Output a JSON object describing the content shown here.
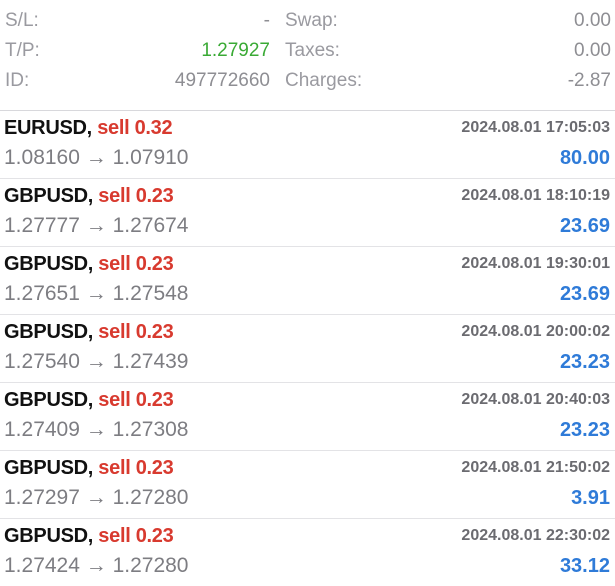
{
  "details": {
    "sl_label": "S/L:",
    "sl_value": "-",
    "tp_label": "T/P:",
    "tp_value": "1.27927",
    "id_label": "ID:",
    "id_value": "497772660",
    "swap_label": "Swap:",
    "swap_value": "0.00",
    "taxes_label": "Taxes:",
    "taxes_value": "0.00",
    "charges_label": "Charges:",
    "charges_value": "-2.87"
  },
  "colors": {
    "sell": "#d83a2f",
    "profit": "#2f7bd8",
    "tp": "#3aaa35"
  },
  "orders": [
    {
      "symbol": "EURUSD,",
      "side": "sell 0.32",
      "time": "2024.08.01 17:05:03",
      "prices": "1.08160 → 1.07910",
      "profit": "80.00"
    },
    {
      "symbol": "GBPUSD,",
      "side": "sell 0.23",
      "time": "2024.08.01 18:10:19",
      "prices": "1.27777 → 1.27674",
      "profit": "23.69"
    },
    {
      "symbol": "GBPUSD,",
      "side": "sell 0.23",
      "time": "2024.08.01 19:30:01",
      "prices": "1.27651 → 1.27548",
      "profit": "23.69"
    },
    {
      "symbol": "GBPUSD,",
      "side": "sell 0.23",
      "time": "2024.08.01 20:00:02",
      "prices": "1.27540 → 1.27439",
      "profit": "23.23"
    },
    {
      "symbol": "GBPUSD,",
      "side": "sell 0.23",
      "time": "2024.08.01 20:40:03",
      "prices": "1.27409 → 1.27308",
      "profit": "23.23"
    },
    {
      "symbol": "GBPUSD,",
      "side": "sell 0.23",
      "time": "2024.08.01 21:50:02",
      "prices": "1.27297 → 1.27280",
      "profit": "3.91"
    },
    {
      "symbol": "GBPUSD,",
      "side": "sell 0.23",
      "time": "2024.08.01 22:30:02",
      "prices": "1.27424 → 1.27280",
      "profit": "33.12"
    }
  ]
}
